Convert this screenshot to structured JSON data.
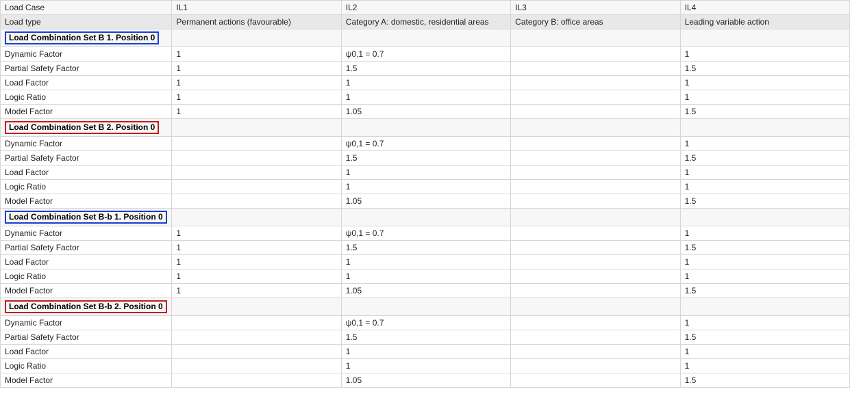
{
  "headers": {
    "load_case": "Load Case",
    "cols": [
      "IL1",
      "IL2",
      "IL3",
      "IL4"
    ]
  },
  "load_type_row": {
    "label": "Load type",
    "values": [
      "Permanent actions (favourable)",
      "Category A: domestic, residential areas",
      "Category B: office areas",
      "Leading variable action"
    ]
  },
  "factor_labels": {
    "dynamic": "Dynamic Factor",
    "psf": "Partial Safety Factor",
    "load": "Load Factor",
    "logic": "Logic Ratio",
    "model": "Model Factor"
  },
  "groups": [
    {
      "title": "Load Combination Set B 1. Position 0",
      "color": "blue",
      "rows": {
        "dynamic": [
          "1",
          "ψ0,1 = 0.7",
          "",
          "1"
        ],
        "psf": [
          "1",
          "1.5",
          "",
          "1.5"
        ],
        "load": [
          "1",
          "1",
          "",
          "1"
        ],
        "logic": [
          "1",
          "1",
          "",
          "1"
        ],
        "model": [
          "1",
          "1.05",
          "",
          "1.5"
        ]
      }
    },
    {
      "title": "Load Combination Set B 2. Position 0",
      "color": "red",
      "rows": {
        "dynamic": [
          "",
          "ψ0,1 = 0.7",
          "",
          "1"
        ],
        "psf": [
          "",
          "1.5",
          "",
          "1.5"
        ],
        "load": [
          "",
          "1",
          "",
          "1"
        ],
        "logic": [
          "",
          "1",
          "",
          "1"
        ],
        "model": [
          "",
          "1.05",
          "",
          "1.5"
        ]
      }
    },
    {
      "title": "Load Combination Set B-b 1. Position 0",
      "color": "blue",
      "rows": {
        "dynamic": [
          "1",
          "ψ0,1 = 0.7",
          "",
          "1"
        ],
        "psf": [
          "1",
          "1.5",
          "",
          "1.5"
        ],
        "load": [
          "1",
          "1",
          "",
          "1"
        ],
        "logic": [
          "1",
          "1",
          "",
          "1"
        ],
        "model": [
          "1",
          "1.05",
          "",
          "1.5"
        ]
      }
    },
    {
      "title": "Load Combination Set B-b 2. Position 0",
      "color": "red",
      "rows": {
        "dynamic": [
          "",
          "ψ0,1 = 0.7",
          "",
          "1"
        ],
        "psf": [
          "",
          "1.5",
          "",
          "1.5"
        ],
        "load": [
          "",
          "1",
          "",
          "1"
        ],
        "logic": [
          "",
          "1",
          "",
          "1"
        ],
        "model": [
          "",
          "1.05",
          "",
          "1.5"
        ]
      }
    }
  ]
}
